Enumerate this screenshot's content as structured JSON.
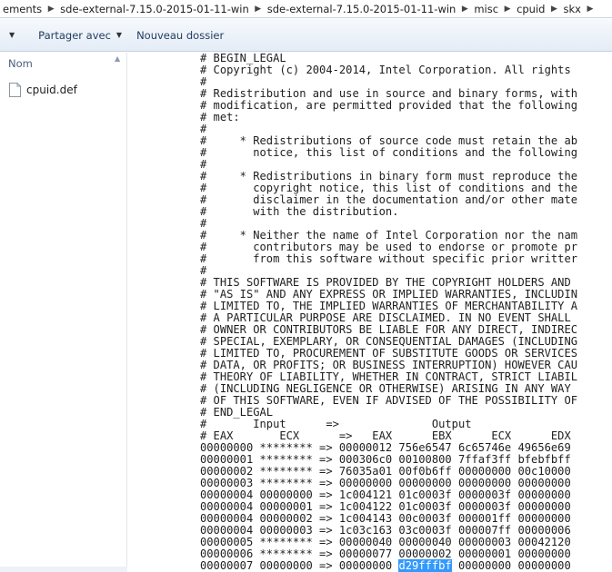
{
  "breadcrumb": {
    "items": [
      "ements",
      "sde-external-7.15.0-2015-01-11-win",
      "sde-external-7.15.0-2015-01-11-win",
      "misc",
      "cpuid",
      "skx"
    ]
  },
  "toolbar": {
    "share_label": "Partager avec",
    "new_folder_label": "Nouveau dossier"
  },
  "navpane": {
    "column_header": "Nom",
    "files": [
      {
        "name": "cpuid.def",
        "icon": "document-icon"
      }
    ]
  },
  "preview": {
    "lines": [
      "# BEGIN_LEGAL",
      "# Copyright (c) 2004-2014, Intel Corporation. All rights",
      "#",
      "# Redistribution and use in source and binary forms, with",
      "# modification, are permitted provided that the following",
      "# met:",
      "#",
      "#     * Redistributions of source code must retain the ab",
      "#       notice, this list of conditions and the following",
      "#",
      "#     * Redistributions in binary form must reproduce the",
      "#       copyright notice, this list of conditions and the",
      "#       disclaimer in the documentation and/or other mate",
      "#       with the distribution.",
      "#",
      "#     * Neither the name of Intel Corporation nor the nam",
      "#       contributors may be used to endorse or promote pr",
      "#       from this software without specific prior writter",
      "#",
      "# THIS SOFTWARE IS PROVIDED BY THE COPYRIGHT HOLDERS AND",
      "# \"AS IS\" AND ANY EXPRESS OR IMPLIED WARRANTIES, INCLUDIN",
      "# LIMITED TO, THE IMPLIED WARRANTIES OF MERCHANTABILITY A",
      "# A PARTICULAR PURPOSE ARE DISCLAIMED. IN NO EVENT SHALL",
      "# OWNER OR CONTRIBUTORS BE LIABLE FOR ANY DIRECT, INDIREC",
      "# SPECIAL, EXEMPLARY, OR CONSEQUENTIAL DAMAGES (INCLUDING",
      "# LIMITED TO, PROCUREMENT OF SUBSTITUTE GOODS OR SERVICES",
      "# DATA, OR PROFITS; OR BUSINESS INTERRUPTION) HOWEVER CAU",
      "# THEORY OF LIABILITY, WHETHER IN CONTRACT, STRICT LIABIL",
      "# (INCLUDING NEGLIGENCE OR OTHERWISE) ARISING IN ANY WAY",
      "# OF THIS SOFTWARE, EVEN IF ADVISED OF THE POSSIBILITY OF",
      "# END_LEGAL",
      "#       Input      =>              Output",
      "# EAX       ECX      =>   EAX      EBX      ECX      EDX",
      "00000000 ******** => 00000012 756e6547 6c65746e 49656e69",
      "00000001 ******** => 000306c0 00100800 7ffaf3ff bfebfbff",
      "00000002 ******** => 76035a01 00f0b6ff 00000000 00c10000",
      "00000003 ******** => 00000000 00000000 00000000 00000000",
      "00000004 00000000 => 1c004121 01c0003f 0000003f 00000000",
      "00000004 00000001 => 1c004122 01c0003f 0000003f 00000000",
      "00000004 00000002 => 1c004143 00c0003f 000001ff 00000000",
      "00000004 00000003 => 1c03c163 03c0003f 000007ff 00000006",
      "00000005 ******** => 00000040 00000040 00000003 00042120",
      "00000006 ******** => 00000077 00000002 00000001 00000000"
    ],
    "last_line": {
      "before": "00000007 00000000 => 00000000 ",
      "selected": "d29fffbf",
      "after": " 00000000 00000000"
    }
  }
}
